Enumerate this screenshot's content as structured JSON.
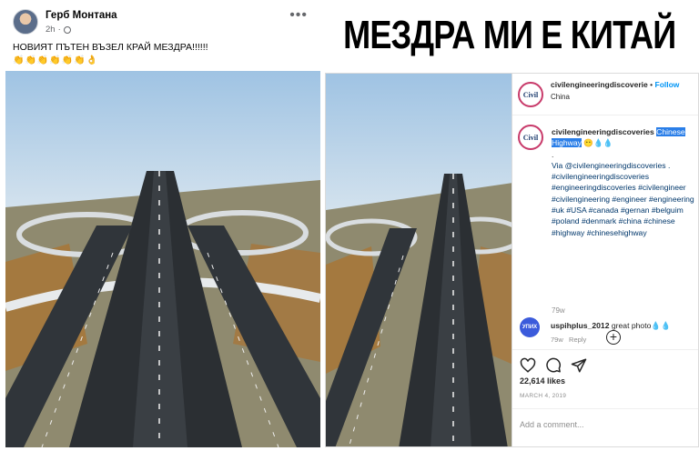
{
  "caption": {
    "text": "МЕЗДРА МИ Е КИТАЙ"
  },
  "facebook": {
    "author": "Герб Монтана",
    "time": "2h",
    "more_label": "•••",
    "post_text": "НОВИЯТ ПЪТЕН ВЪЗЕЛ КРАЙ МЕЗДРА!!!!!!",
    "emoji": "👏👏👏👏👏👏👌"
  },
  "instagram": {
    "logo_text": "Civil",
    "username": "civilengineeringdiscoverie",
    "dot": "•",
    "follow_label": "Follow",
    "location": "China",
    "caption_user": "civilengineeringdiscoveries",
    "caption_highlight_1": "Chinese",
    "caption_highlight_2": "Highway",
    "caption_emoji": "😶💧💧",
    "caption_dot": ".",
    "caption_body": "Via @civilengineeringdiscoveries . #civilengineeringdiscoveries #engineeringdiscoveries #civilengineer #civilengineering #engineer #engineering #uk #USA #canada #gernan #belguim #poland #denmark #china #chinese #highway #chinesehighway",
    "caption_age": "79w",
    "comment": {
      "avatar_text": "УПИХ",
      "user": "uspihplus_2012",
      "text": "great photo💧💧",
      "age": "79w",
      "reply_label": "Reply"
    },
    "likes": "22,614 likes",
    "date": "MARCH 4, 2019",
    "add_comment_placeholder": "Add a comment..."
  },
  "colors": {
    "instagram_link": "#0095f6",
    "selection": "#2a7ee8",
    "hashtag": "#00376b"
  },
  "icons": [
    "globe-icon",
    "more-options-icon",
    "plus-circle-icon",
    "heart-icon",
    "comment-icon",
    "share-icon"
  ]
}
